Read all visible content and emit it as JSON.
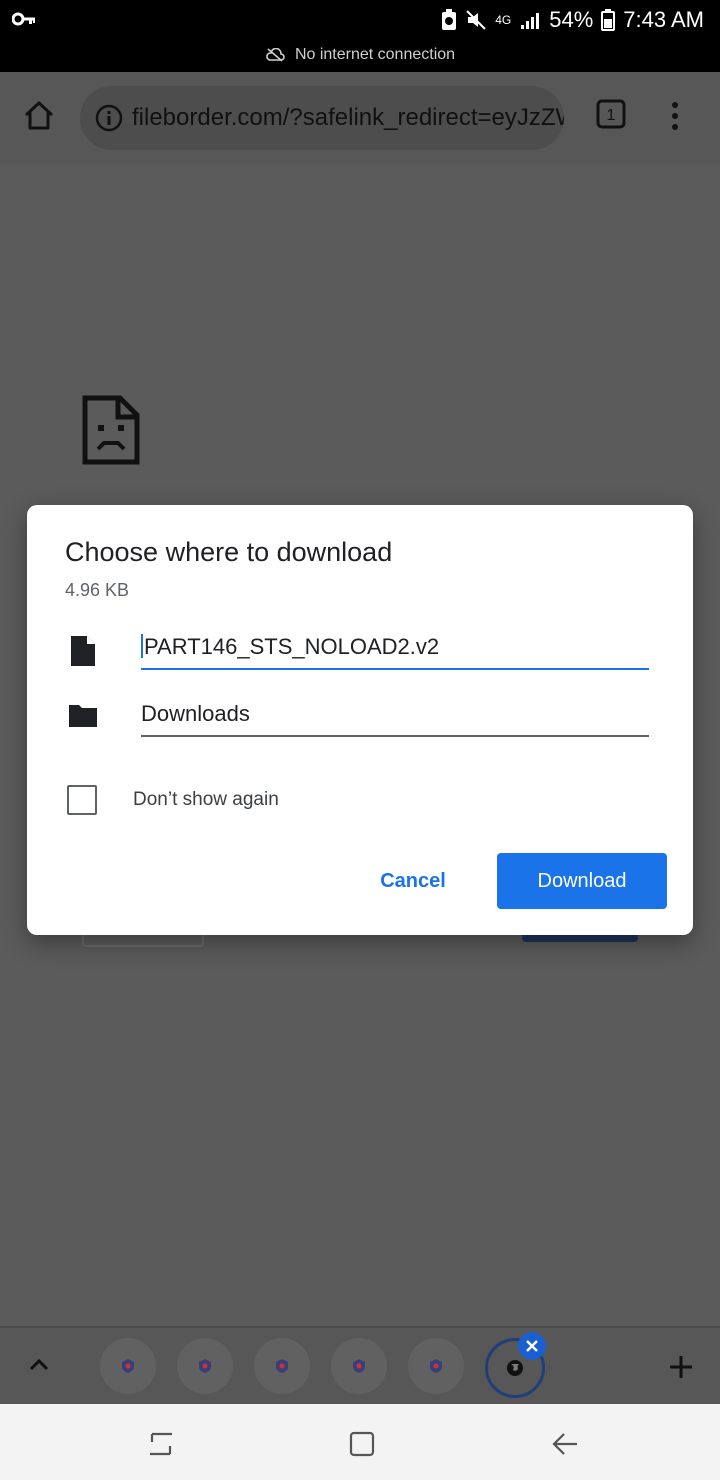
{
  "status_bar": {
    "battery": "54%",
    "time": "7:43 AM",
    "network": "4G",
    "banner": "No internet connection"
  },
  "browser": {
    "url": "fileborder.com/?safelink_redirect=eyJzZW",
    "tab_count": "1"
  },
  "dialog": {
    "title": "Choose where to download",
    "size": "4.96 KB",
    "filename": "PART146_STS_NOLOAD2.v2",
    "location": "Downloads",
    "dont_show_label": "Don’t show again",
    "cancel_label": "Cancel",
    "download_label": "Download",
    "dont_show_checked": false
  },
  "colors": {
    "accent": "#1a73e8",
    "scrim": "#5b5b5b",
    "dialog_bg": "#ffffff"
  },
  "icons": {
    "status_left": "key-icon",
    "home": "home-icon",
    "info": "info-icon",
    "menu": "more-vert-icon",
    "file": "file-icon",
    "folder": "folder-icon",
    "sad_page": "sad-page-icon"
  }
}
